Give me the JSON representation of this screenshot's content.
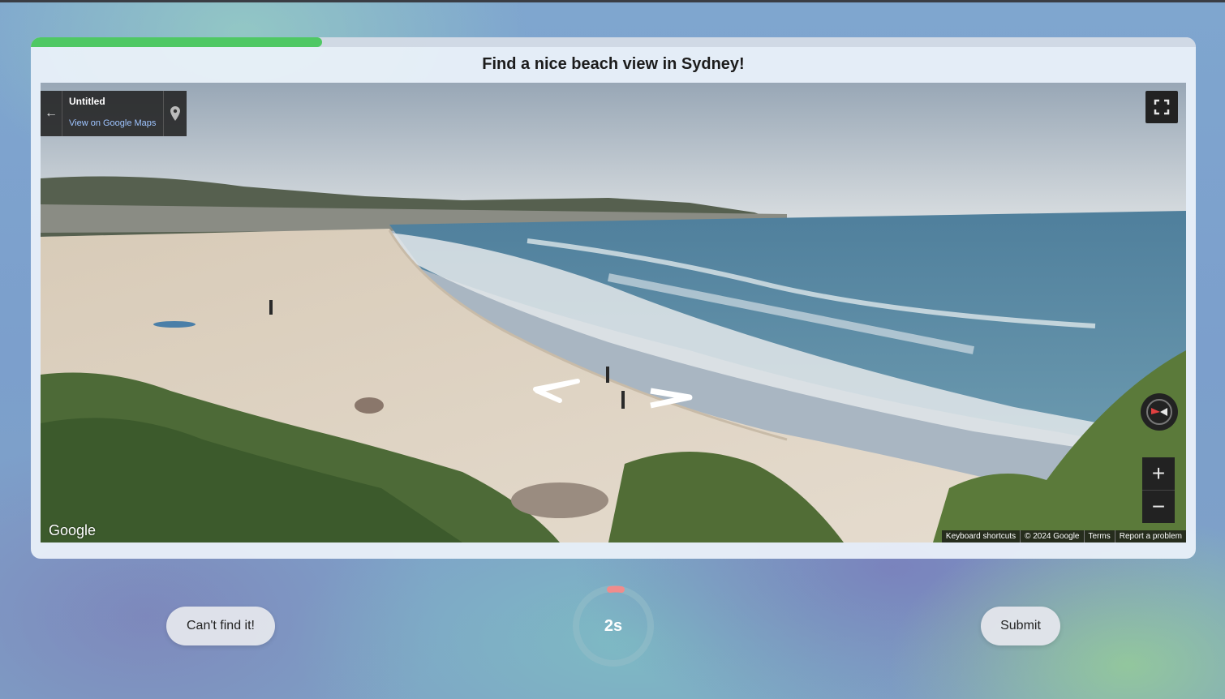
{
  "task": {
    "prompt": "Find a nice beach view in Sydney!",
    "progress_fraction": 0.25
  },
  "streetview": {
    "info": {
      "title": "Untitled",
      "link": "View on Google Maps"
    },
    "logo_text": "Google",
    "footer": [
      "Keyboard shortcuts",
      "© 2024 Google",
      "Terms",
      "Report a problem"
    ],
    "zoom_in_label": "+",
    "zoom_out_label": "−",
    "icons": [
      "back-arrow-icon",
      "map-pin-icon",
      "fullscreen-icon",
      "compass-icon",
      "nav-arrow-left-icon",
      "nav-arrow-right-icon"
    ]
  },
  "controls": {
    "cant_find_label": "Can't find it!",
    "submit_label": "Submit",
    "timer_text": "2s"
  },
  "colors": {
    "progress": "#4fc864",
    "timer_accent": "#f08c8c"
  }
}
